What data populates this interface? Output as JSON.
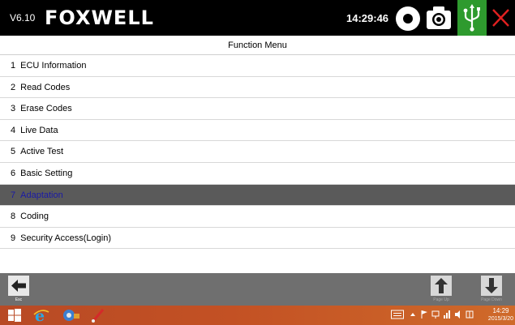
{
  "header": {
    "version": "V6.10",
    "brand": "FOXWELL",
    "time": "14:29:46"
  },
  "title": "Function Menu",
  "menu": {
    "items": [
      {
        "num": "1",
        "label": "ECU Information",
        "selected": false
      },
      {
        "num": "2",
        "label": "Read Codes",
        "selected": false
      },
      {
        "num": "3",
        "label": "Erase Codes",
        "selected": false
      },
      {
        "num": "4",
        "label": "Live Data",
        "selected": false
      },
      {
        "num": "5",
        "label": "Active Test",
        "selected": false
      },
      {
        "num": "6",
        "label": "Basic Setting",
        "selected": false
      },
      {
        "num": "7",
        "label": "Adaptation",
        "selected": true
      },
      {
        "num": "8",
        "label": "Coding",
        "selected": false
      },
      {
        "num": "9",
        "label": "Security Access(Login)",
        "selected": false
      }
    ]
  },
  "toolbar": {
    "esc_label": "Esc",
    "page_up_label": "Page Up",
    "page_down_label": "Page Down"
  },
  "taskbar": {
    "clock_time": "14:29",
    "clock_date": "2015/3/20"
  },
  "colors": {
    "header_bg": "#000000",
    "usb_green": "#2e9a2e",
    "close_red": "#e02020",
    "selected_row_bg": "#5a5a5a",
    "selected_text": "#1a1aa6",
    "toolbar_bg": "#6f6f6f",
    "taskbar_bg": "#c35124"
  },
  "icons": {
    "record": "record-icon",
    "camera": "camera-icon",
    "usb": "usb-icon",
    "close": "close-icon",
    "back": "arrow-left-icon",
    "page_up": "arrow-up-icon",
    "page_down": "arrow-down-icon"
  }
}
